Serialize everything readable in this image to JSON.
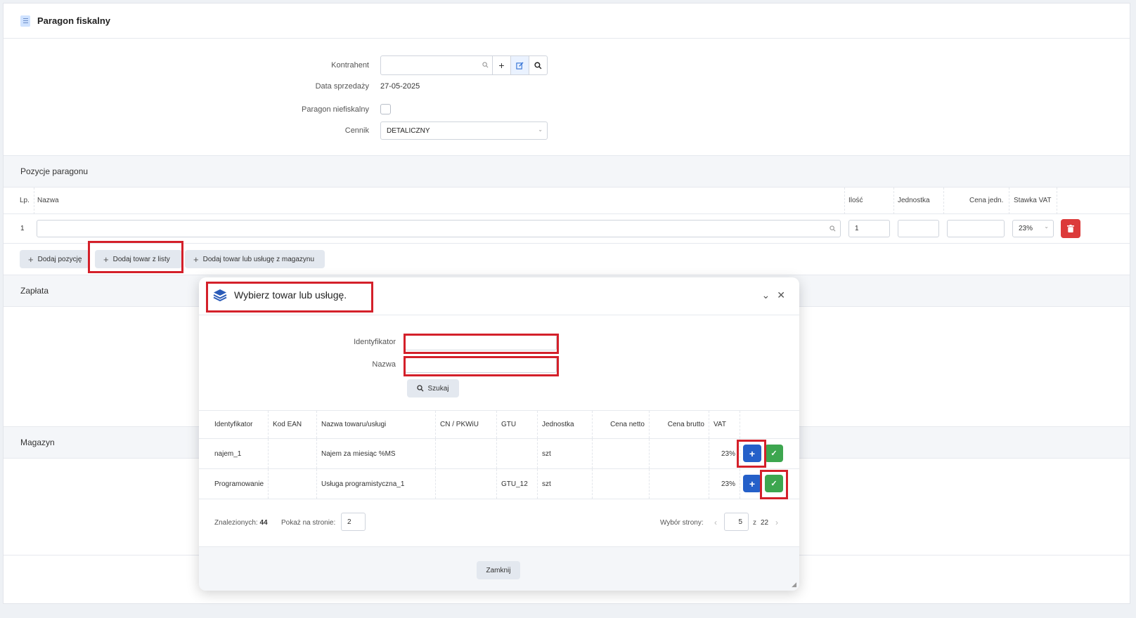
{
  "page": {
    "title": "Paragon fiskalny"
  },
  "form": {
    "contractor_label": "Kontrahent",
    "sale_date_label": "Data sprzedaży",
    "sale_date_value": "27-05-2025",
    "nonfiscal_label": "Paragon niefiskalny",
    "pricelist_label": "Cennik",
    "pricelist_value": "DETALICZNY"
  },
  "positions": {
    "section_title": "Pozycje paragonu",
    "columns": [
      "Lp.",
      "Nazwa",
      "Ilość",
      "Jednostka",
      "Cena jedn.",
      "Stawka VAT"
    ],
    "rows": [
      {
        "lp": "1",
        "name": "",
        "qty": "1",
        "unit": "",
        "price": "",
        "vat": "23%"
      }
    ],
    "buttons": {
      "add_position": "Dodaj pozycję",
      "add_from_list": "Dodaj towar z listy",
      "add_from_warehouse": "Dodaj towar lub usługę z magazynu"
    }
  },
  "sections": {
    "payment": "Zapłata",
    "warehouse": "Magazyn"
  },
  "modal": {
    "title": "Wybierz towar lub usługę.",
    "id_label": "Identyfikator",
    "name_label": "Nazwa",
    "search_button": "Szukaj",
    "columns": [
      "Identyfikator",
      "Kod EAN",
      "Nazwa towaru/usługi",
      "CN / PKWiU",
      "GTU",
      "Jednostka",
      "Cena netto",
      "Cena brutto",
      "VAT"
    ],
    "rows": [
      {
        "id": "najem_1",
        "ean": "",
        "name": "Najem za miesiąc %MS",
        "cn": "",
        "gtu": "",
        "unit": "szt",
        "net": "",
        "gross": "",
        "vat": "23%"
      },
      {
        "id": "Programowanie",
        "ean": "",
        "name": "Usługa programistyczna_1",
        "cn": "",
        "gtu": "GTU_12",
        "unit": "szt",
        "net": "",
        "gross": "",
        "vat": "23%"
      }
    ],
    "pager": {
      "found_label": "Znalezionych:",
      "found_count": "44",
      "per_page_label": "Pokaż na stronie:",
      "per_page_value": "2",
      "page_label": "Wybór strony:",
      "current_page": "5",
      "of_label": "z",
      "total_pages": "22"
    },
    "close_button": "Zamknij"
  },
  "colors": {
    "accent_blue": "#2560c9",
    "accept_green": "#3da64f",
    "delete_red": "#dc3a3a",
    "highlight_red": "#d4202a"
  }
}
